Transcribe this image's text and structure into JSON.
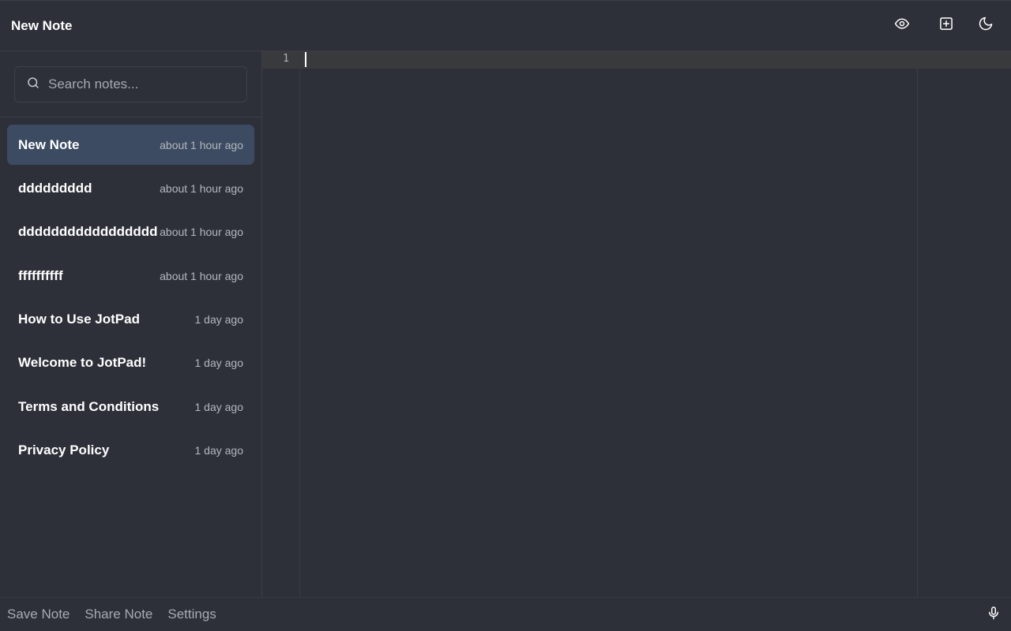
{
  "header": {
    "title": "New Note",
    "actions": [
      {
        "icon": "eye-icon"
      },
      {
        "icon": "plus-square-icon"
      },
      {
        "icon": "moon-icon"
      }
    ]
  },
  "sidebar": {
    "search": {
      "placeholder": "Search notes...",
      "value": ""
    },
    "notes": [
      {
        "title": "New Note",
        "time": "about 1 hour ago",
        "active": true
      },
      {
        "title": "ddddddddd",
        "time": "about 1 hour ago",
        "active": false
      },
      {
        "title": "ddddddddddddddddd",
        "time": "about 1 hour ago",
        "active": false
      },
      {
        "title": "ffffffffff",
        "time": "about 1 hour ago",
        "active": false
      },
      {
        "title": "How to Use JotPad",
        "time": "1 day ago",
        "active": false
      },
      {
        "title": "Welcome to JotPad!",
        "time": "1 day ago",
        "active": false
      },
      {
        "title": "Terms and Conditions",
        "time": "1 day ago",
        "active": false
      },
      {
        "title": "Privacy Policy",
        "time": "1 day ago",
        "active": false
      }
    ]
  },
  "editor": {
    "line_numbers": [
      "1"
    ],
    "content": ""
  },
  "footer": {
    "save_label": "Save Note",
    "share_label": "Share Note",
    "settings_label": "Settings",
    "mic_icon": "microphone-icon"
  },
  "colors": {
    "background": "#2d3039",
    "active_note": "#3c4b61",
    "muted_text": "#a8abb2"
  }
}
